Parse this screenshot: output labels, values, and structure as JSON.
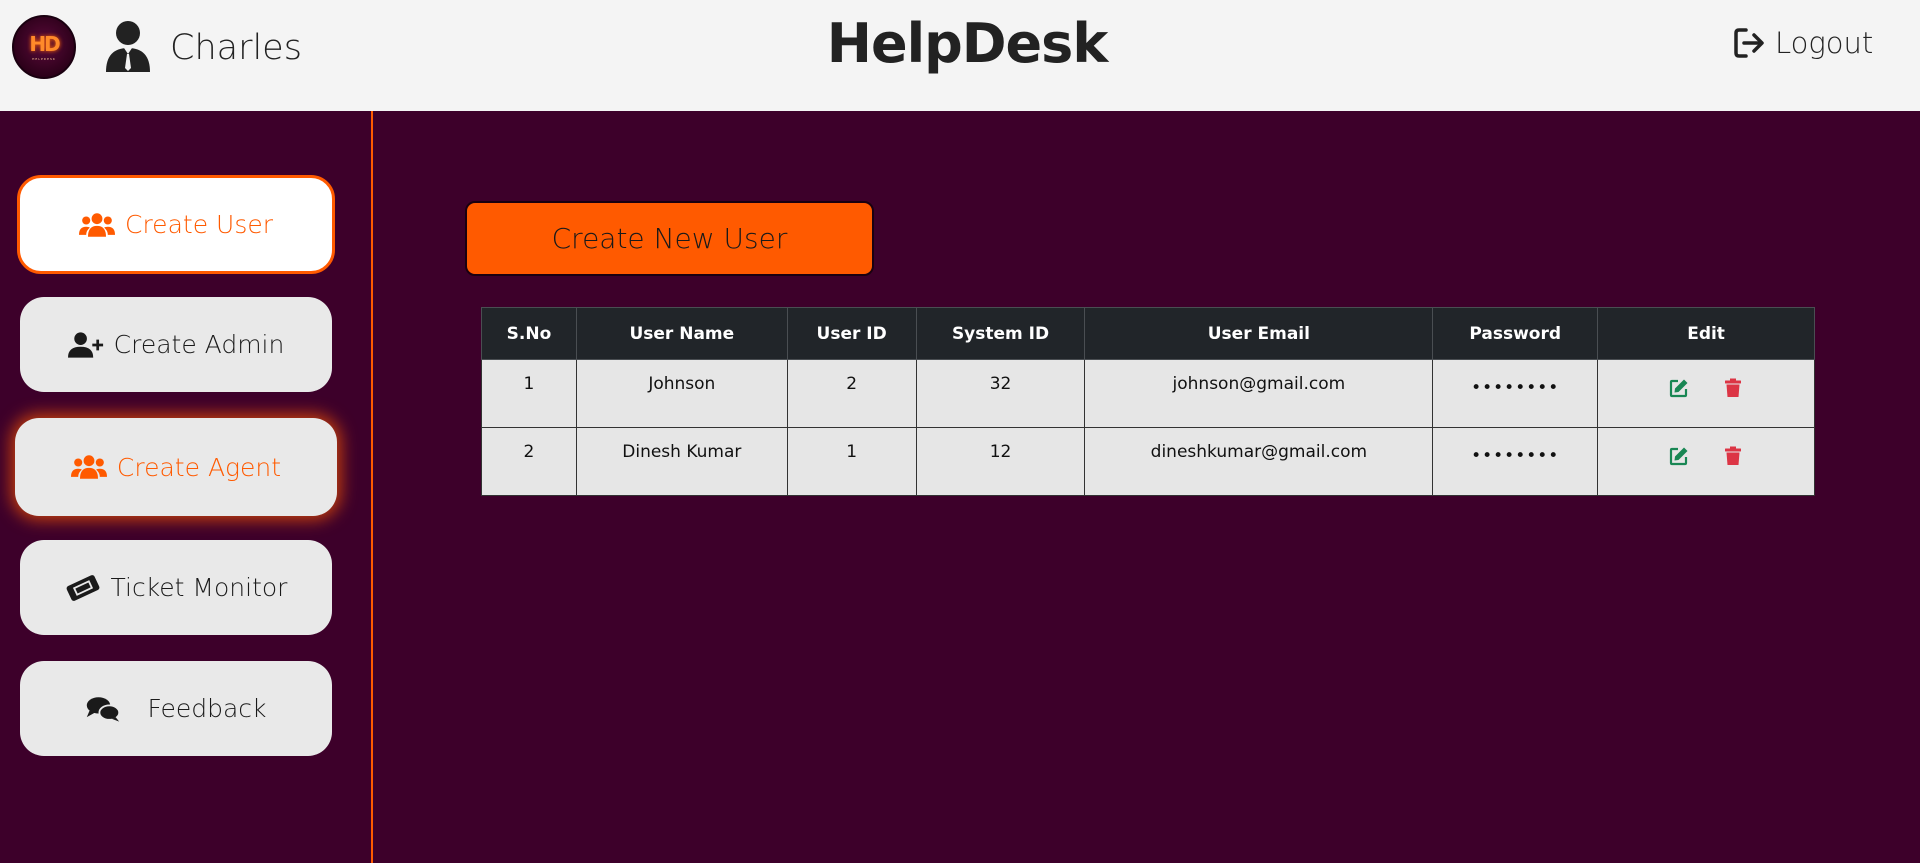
{
  "header": {
    "logo_text": "HD",
    "logo_subtext": "HELPDESK",
    "user_name": "Charles",
    "app_title": "HelpDesk",
    "logout_label": "Logout"
  },
  "sidebar": {
    "items": [
      {
        "label": "Create User",
        "icon": "users-icon",
        "state": "active"
      },
      {
        "label": "Create Admin",
        "icon": "user-plus-icon"
      },
      {
        "label": "Create Agent",
        "icon": "users-icon",
        "state": "hover"
      },
      {
        "label": "Ticket Monitor",
        "icon": "ticket-icon"
      },
      {
        "label": "Feedback",
        "icon": "comments-icon"
      }
    ]
  },
  "main": {
    "create_button_label": "Create New User",
    "table": {
      "columns": [
        "S.No",
        "User Name",
        "User ID",
        "System ID",
        "User Email",
        "Password",
        "Edit"
      ],
      "rows": [
        {
          "sno": "1",
          "name": "Johnson",
          "user_id": "2",
          "system_id": "32",
          "email": "johnson@gmail.com",
          "password": "••••••••"
        },
        {
          "sno": "2",
          "name": "Dinesh Kumar",
          "user_id": "1",
          "system_id": "12",
          "email": "dineshkumar@gmail.com",
          "password": "••••••••"
        }
      ]
    }
  },
  "colors": {
    "accent": "#ff5a00",
    "background": "#3d002a",
    "header_bg": "#f4f4f4",
    "table_header": "#212529",
    "edit_green": "#198754",
    "delete_red": "#dc3545"
  }
}
